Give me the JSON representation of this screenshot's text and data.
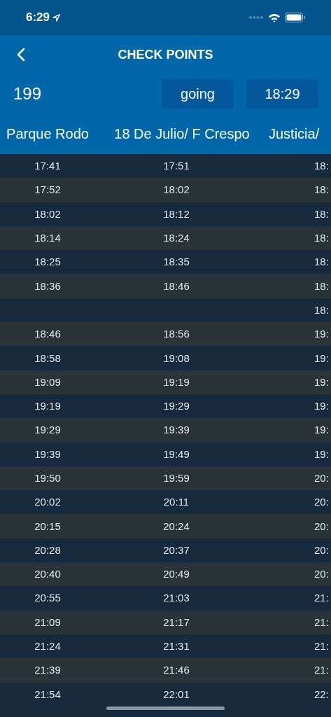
{
  "status_bar": {
    "time": "6:29"
  },
  "nav": {
    "title": "CHECK POINTS"
  },
  "route": {
    "number": "199",
    "direction": "going",
    "time": "18:29"
  },
  "table": {
    "columns": [
      "Parque Rodo",
      "18 De Julio/ F Crespo",
      "Justicia/"
    ],
    "rows": [
      [
        "17:41",
        "17:51",
        "18:"
      ],
      [
        "17:52",
        "18:02",
        "18:"
      ],
      [
        "18:02",
        "18:12",
        "18:"
      ],
      [
        "18:14",
        "18:24",
        "18:"
      ],
      [
        "18:25",
        "18:35",
        "18:"
      ],
      [
        "18:36",
        "18:46",
        "18:"
      ],
      [
        "",
        "",
        "18:"
      ],
      [
        "18:46",
        "18:56",
        "19:"
      ],
      [
        "18:58",
        "19:08",
        "19:"
      ],
      [
        "19:09",
        "19:19",
        "19:"
      ],
      [
        "19:19",
        "19:29",
        "19:"
      ],
      [
        "19:29",
        "19:39",
        "19:"
      ],
      [
        "19:39",
        "19:49",
        "19:"
      ],
      [
        "19:50",
        "19:59",
        "20:"
      ],
      [
        "20:02",
        "20:11",
        "20:"
      ],
      [
        "20:15",
        "20:24",
        "20:"
      ],
      [
        "20:28",
        "20:37",
        "20:"
      ],
      [
        "20:40",
        "20:49",
        "20:"
      ],
      [
        "20:55",
        "21:03",
        "21:"
      ],
      [
        "21:09",
        "21:17",
        "21:"
      ],
      [
        "21:24",
        "21:31",
        "21:"
      ],
      [
        "21:39",
        "21:46",
        "21:"
      ],
      [
        "21:54",
        "22:01",
        "22:"
      ]
    ]
  }
}
